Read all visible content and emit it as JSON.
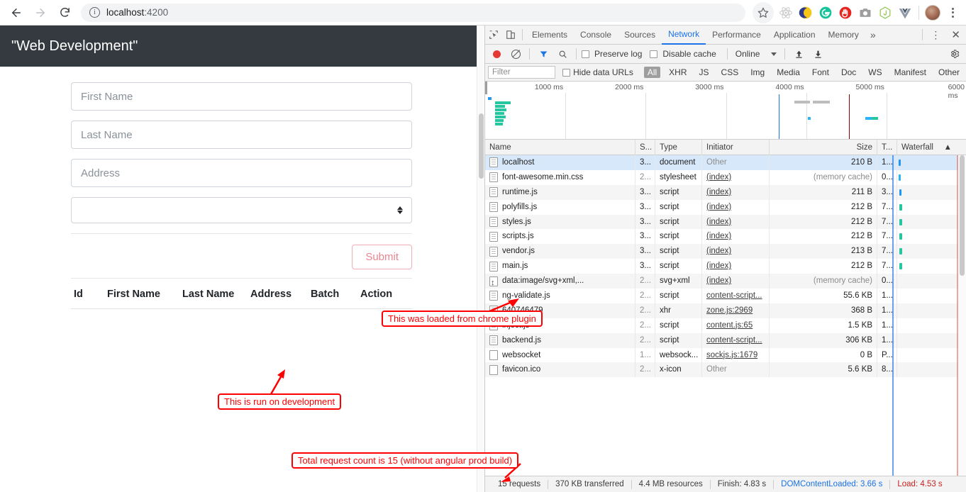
{
  "browser": {
    "back_icon": "arrow-left-icon",
    "forward_icon": "arrow-right-icon",
    "reload_icon": "reload-icon",
    "info_glyph": "i",
    "url_host": "localhost",
    "url_port": ":4200",
    "url_full": "localhost:4200",
    "star_icon": "bookmark-star-icon",
    "extensions": [
      {
        "name": "react-devtools-extension-icon",
        "glyph": "⚛"
      },
      {
        "name": "dark-reader-extension-icon",
        "glyph": "☾"
      },
      {
        "name": "grammarly-extension-icon",
        "glyph": "G"
      },
      {
        "name": "adblock-extension-icon",
        "glyph": "✋"
      },
      {
        "name": "screenshot-extension-icon",
        "glyph": "▣"
      },
      {
        "name": "nodejs-extension-icon",
        "glyph": "JS"
      },
      {
        "name": "vue-devtools-extension-icon",
        "glyph": "V"
      }
    ],
    "avatar_name": "profile-avatar",
    "menu_icon": "chrome-menu-kebab-icon"
  },
  "page": {
    "navbar_title": "\"Web Development\"",
    "navbar_color": "#343a40",
    "fields": [
      {
        "name": "first-name-input",
        "placeholder": "First Name",
        "value": ""
      },
      {
        "name": "last-name-input",
        "placeholder": "Last Name",
        "value": ""
      },
      {
        "name": "address-input",
        "placeholder": "Address",
        "value": ""
      }
    ],
    "batch_select": {
      "name": "batch-select",
      "value": "",
      "icon": "stepper-arrows-icon"
    },
    "submit_label": "Submit",
    "submit_color": "#e9868f",
    "table_headers": [
      "Id",
      "First Name",
      "Last Name",
      "Address",
      "Batch",
      "Action"
    ],
    "table_rows": []
  },
  "devtools": {
    "inspect_icon": "inspect-element-icon",
    "device_icon": "device-toolbar-icon",
    "tabs": [
      {
        "label": "Elements",
        "active": false
      },
      {
        "label": "Console",
        "active": false
      },
      {
        "label": "Sources",
        "active": false
      },
      {
        "label": "Network",
        "active": true
      },
      {
        "label": "Performance",
        "active": false
      },
      {
        "label": "Application",
        "active": false
      },
      {
        "label": "Memory",
        "active": false
      }
    ],
    "more_tabs_glyph": "»",
    "menu_glyph": "⋮",
    "close_glyph": "✕",
    "toolbar": {
      "record_icon": "record-button",
      "clear_icon": "clear-button",
      "filter_icon": "filter-funnel-icon",
      "search_icon": "search-icon",
      "preserve_log_label": "Preserve log",
      "preserve_log_checked": false,
      "disable_cache_label": "Disable cache",
      "disable_cache_checked": false,
      "throttle_value": "Online",
      "import_icon": "import-har-icon",
      "export_icon": "export-har-icon",
      "settings_icon": "gear-icon"
    },
    "filterbar": {
      "filter_placeholder": "Filter",
      "filter_value": "",
      "hide_data_urls_label": "Hide data URLs",
      "hide_data_urls_checked": false,
      "type_chips": [
        "All",
        "XHR",
        "JS",
        "CSS",
        "Img",
        "Media",
        "Font",
        "Doc",
        "WS",
        "Manifest",
        "Other"
      ],
      "active_chip": "All"
    },
    "overview": {
      "tick_labels": [
        "1000 ms",
        "2000 ms",
        "3000 ms",
        "4000 ms",
        "5000 ms",
        "6000 ms"
      ],
      "dcl_color": "#1a73e8",
      "load_color": "#8b0000"
    },
    "columns": [
      "Name",
      "S...",
      "Type",
      "Initiator",
      "Size",
      "T...",
      "Waterfall"
    ],
    "sort_indicator": "▲",
    "requests": [
      {
        "name": "localhost",
        "icon": "document-icon",
        "status": "3...",
        "type": "document",
        "initiator": "Other",
        "initiator_link": false,
        "size": "210 B",
        "size_dim": false,
        "time": "1...",
        "selected": true
      },
      {
        "name": "font-awesome.min.css",
        "icon": "document-icon",
        "status": "2...",
        "status_dim": true,
        "type": "stylesheet",
        "initiator": "(index)",
        "initiator_link": true,
        "size": "(memory cache)",
        "size_dim": true,
        "time": "0...",
        "selected": false
      },
      {
        "name": "runtime.js",
        "icon": "document-icon",
        "status": "3...",
        "type": "script",
        "initiator": "(index)",
        "initiator_link": true,
        "size": "211 B",
        "size_dim": false,
        "time": "3...",
        "selected": false
      },
      {
        "name": "polyfills.js",
        "icon": "document-icon",
        "status": "3...",
        "type": "script",
        "initiator": "(index)",
        "initiator_link": true,
        "size": "212 B",
        "size_dim": false,
        "time": "7...",
        "selected": false
      },
      {
        "name": "styles.js",
        "icon": "document-icon",
        "status": "3...",
        "type": "script",
        "initiator": "(index)",
        "initiator_link": true,
        "size": "212 B",
        "size_dim": false,
        "time": "7...",
        "selected": false
      },
      {
        "name": "scripts.js",
        "icon": "document-icon",
        "status": "3...",
        "type": "script",
        "initiator": "(index)",
        "initiator_link": true,
        "size": "212 B",
        "size_dim": false,
        "time": "7...",
        "selected": false
      },
      {
        "name": "vendor.js",
        "icon": "document-icon",
        "status": "3...",
        "type": "script",
        "initiator": "(index)",
        "initiator_link": true,
        "size": "213 B",
        "size_dim": false,
        "time": "7...",
        "selected": false
      },
      {
        "name": "main.js",
        "icon": "document-icon",
        "status": "3...",
        "type": "script",
        "initiator": "(index)",
        "initiator_link": true,
        "size": "212 B",
        "size_dim": false,
        "time": "7...",
        "selected": false
      },
      {
        "name": "data:image/svg+xml,...",
        "icon": "data-url-icon",
        "status": "2...",
        "status_dim": true,
        "type": "svg+xml",
        "initiator": "(index)",
        "initiator_link": true,
        "size": "(memory cache)",
        "size_dim": true,
        "time": "0...",
        "selected": false
      },
      {
        "name": "ng-validate.js",
        "icon": "document-icon",
        "status": "2...",
        "status_dim": true,
        "type": "script",
        "initiator": "content-script...",
        "initiator_link": true,
        "size": "55.6 KB",
        "size_dim": false,
        "time": "1...",
        "selected": false
      },
      {
        "name": "640746479",
        "icon": "document-icon",
        "status": "2...",
        "status_dim": true,
        "type": "xhr",
        "initiator": "zone.js:2969",
        "initiator_link": true,
        "size": "368 B",
        "size_dim": false,
        "time": "1...",
        "selected": false
      },
      {
        "name": "inject.js",
        "icon": "document-icon",
        "status": "2...",
        "status_dim": true,
        "type": "script",
        "initiator": "content.js:65",
        "initiator_link": true,
        "size": "1.5 KB",
        "size_dim": false,
        "time": "1...",
        "selected": false
      },
      {
        "name": "backend.js",
        "icon": "document-icon",
        "status": "2...",
        "status_dim": true,
        "type": "script",
        "initiator": "content-script...",
        "initiator_link": true,
        "size": "306 KB",
        "size_dim": false,
        "time": "1...",
        "selected": false
      },
      {
        "name": "websocket",
        "icon": "blank-icon",
        "status": "1...",
        "status_dim": true,
        "type": "websock...",
        "initiator": "sockjs.js:1679",
        "initiator_link": true,
        "size": "0 B",
        "size_dim": false,
        "time": "P...",
        "selected": false
      },
      {
        "name": "favicon.ico",
        "icon": "blank-icon",
        "status": "2...",
        "status_dim": true,
        "type": "x-icon",
        "initiator": "Other",
        "initiator_link": false,
        "size": "5.6 KB",
        "size_dim": false,
        "time": "8...",
        "selected": false
      }
    ],
    "status": {
      "requests": "15 requests",
      "transferred": "370 KB transferred",
      "resources": "4.4 MB resources",
      "finish": "Finish: 4.83 s",
      "dom_content_loaded": "DOMContentLoaded: 3.66 s",
      "load": "Load: 4.53 s"
    }
  },
  "annotations": [
    {
      "name": "annotation-chrome-plugin",
      "text": "This was loaded from chrome plugin"
    },
    {
      "name": "annotation-development",
      "text": "This is run on development"
    },
    {
      "name": "annotation-request-count",
      "text": "Total request count is 15 (without angular prod build)"
    }
  ]
}
